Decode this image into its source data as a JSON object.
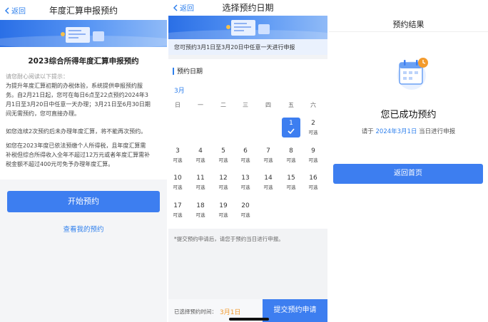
{
  "common": {
    "back_label": "返回"
  },
  "panel1": {
    "nav_title": "年度汇算申报预约",
    "heading": "2023综合所得年度汇算申报预约",
    "hint": "请您耐心阅读以下提示：",
    "paragraphs": {
      "a": [
        "为提升年度汇算初期的办税体验，系统提供申报预约服",
        "务。自2月21日起，您可在每日6点至22点预约2024年3",
        "月1日至3月20日中任意一天办理；3月21日至6月30日期",
        "间无需预约，您可直接办理。"
      ],
      "b": [
        "如您连续2次预约后未办理年度汇算，将不能再次预约。"
      ],
      "c": [
        "如您在2023年度已依法预缴个人所得税，且年度汇算需",
        "补税但综合所得收入全年不超过12万元或者年度汇算需补",
        "税金额不超过400元可免予办理年度汇算。"
      ]
    },
    "start_button": "开始预约",
    "my_link": "查看我的预约"
  },
  "panel2": {
    "nav_title": "选择预约日期",
    "notice": "您可预约3月1日至3月20日中任意一天进行申报",
    "section_title": "预约日期",
    "month": "3月",
    "weekdays": [
      "日",
      "一",
      "二",
      "三",
      "四",
      "五",
      "六"
    ],
    "days": [
      {
        "n": "1",
        "s": "",
        "selected": true
      },
      {
        "n": "2",
        "s": "可选"
      },
      {
        "n": "3",
        "s": "可选"
      },
      {
        "n": "4",
        "s": "可选"
      },
      {
        "n": "5",
        "s": "可选"
      },
      {
        "n": "6",
        "s": "可选"
      },
      {
        "n": "7",
        "s": "可选"
      },
      {
        "n": "8",
        "s": "可选"
      },
      {
        "n": "9",
        "s": "可选"
      },
      {
        "n": "10",
        "s": "可选"
      },
      {
        "n": "11",
        "s": "可选"
      },
      {
        "n": "12",
        "s": "可选"
      },
      {
        "n": "13",
        "s": "可选"
      },
      {
        "n": "14",
        "s": "可选"
      },
      {
        "n": "15",
        "s": "可选"
      },
      {
        "n": "16",
        "s": "可选"
      },
      {
        "n": "17",
        "s": "可选"
      },
      {
        "n": "18",
        "s": "可选"
      },
      {
        "n": "19",
        "s": "可选"
      },
      {
        "n": "20",
        "s": "可选"
      }
    ],
    "footnote": "*提交预约申请后，请您于预约当日进行申报。",
    "selected_label": "已选择预约时间：",
    "selected_value": "3月1日",
    "submit_button": "提交预约申请"
  },
  "panel3": {
    "nav_title": "预约结果",
    "success_title": "您已成功预约",
    "line_prefix": "请于",
    "line_date": "2024年3月1日",
    "line_suffix": "当日进行申报",
    "home_button": "返回首页"
  },
  "colors": {
    "accent": "#3d7ef0",
    "link": "#2f80ed",
    "orange": "#f39b2d"
  }
}
